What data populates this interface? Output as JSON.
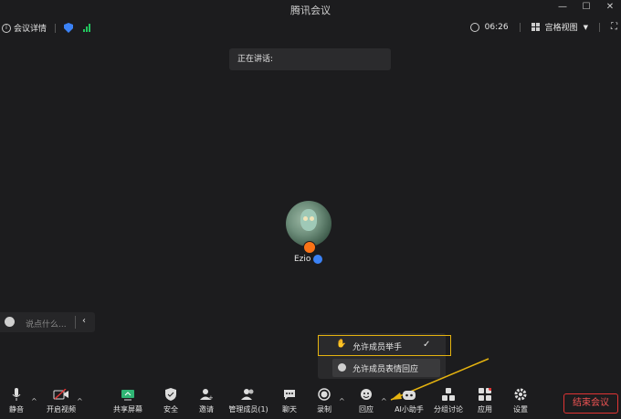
{
  "window": {
    "title": "腾讯会议",
    "controls": [
      "—",
      "☐",
      "✕"
    ]
  },
  "topbar": {
    "meeting_details": "会议详情",
    "timer": "06:26",
    "view_mode": "宫格视图"
  },
  "speaker": {
    "label": "正在讲话:"
  },
  "participant": {
    "name": "Ezio"
  },
  "chat": {
    "placeholder": "说点什么..."
  },
  "popup": {
    "option1": "允许成员举手",
    "option2": "允许成员表情回应"
  },
  "toolbar": {
    "mute": "静音",
    "video": "开启视频",
    "share": "共享屏幕",
    "security": "安全",
    "invite": "邀请",
    "manage": "管理成员(1)",
    "chat": "聊天",
    "record": "录制",
    "reactions": "回应",
    "ai": "AI小助手",
    "breakout": "分组讨论",
    "apps": "应用",
    "settings": "设置",
    "end": "结束会议"
  },
  "colors": {
    "accent": "#3b82f6",
    "highlight": "#e5b30f",
    "danger": "#e03434",
    "signal": "#22c55e"
  }
}
